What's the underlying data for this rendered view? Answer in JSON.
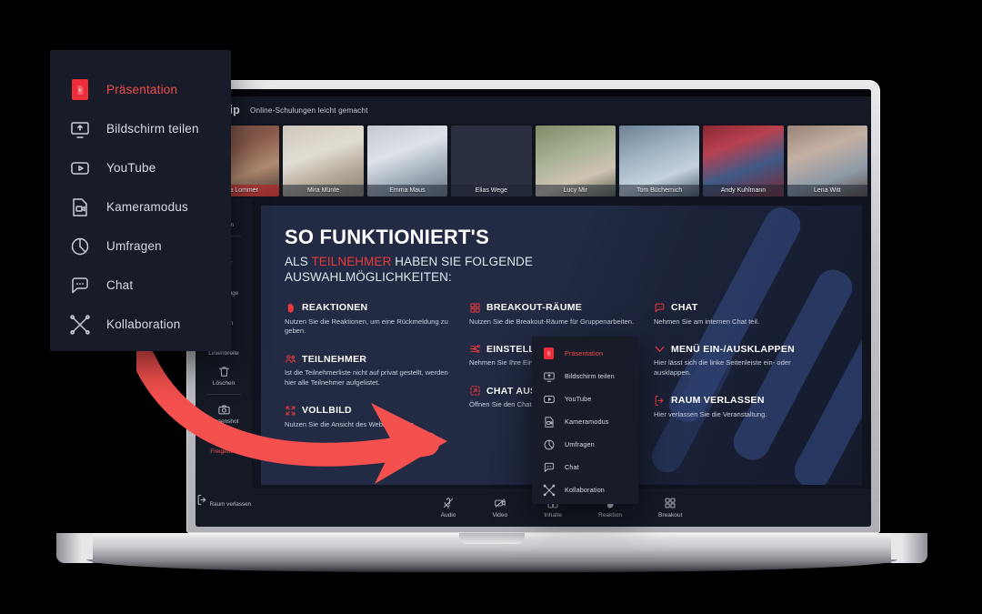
{
  "app": {
    "brand": "dudip",
    "tagline": "Online-Schulungen leicht gemacht"
  },
  "participants": [
    {
      "name": "Anja Lommer",
      "active": true,
      "bg": "linear-gradient(160deg,#6d4a42 0%,#8a5c4c 35%,#b08a72 65%,#4a3730 100%)"
    },
    {
      "name": "Mira Münte",
      "active": false,
      "bg": "linear-gradient(160deg,#cfc6bb 0%,#e2ddd4 40%,#b3a898 70%,#8e8275 100%)"
    },
    {
      "name": "Emma Maus",
      "active": false,
      "bg": "linear-gradient(160deg,#c3c9cf 0%,#dde3e8 38%,#9aa6b2 72%,#6c7884 100%)"
    },
    {
      "name": "Elias Wege",
      "active": false,
      "bg": "linear-gradient(160deg,#7a6a57 0%,#a89madd 0%,#9c8b72 45%,#5e4f3e 100%)"
    },
    {
      "name": "Lucy Mir",
      "active": false,
      "bg": "linear-gradient(160deg,#7e8c6a 0%,#a8b394 40%,#cfc3b2 70%,#5b6450 100%)"
    },
    {
      "name": "Tom Büchernich",
      "active": false,
      "bg": "linear-gradient(160deg,#6e8296 0%,#9fb3c4 38%,#c6d2dc 68%,#4e5e6e 100%)"
    },
    {
      "name": "Andy Kuhlmann",
      "active": false,
      "bg": "linear-gradient(160deg,#8a2733 0%,#b8414f 30%,#3f5a86 60%,#7b2631 100%)"
    },
    {
      "name": "Lena Witt",
      "active": false,
      "bg": "linear-gradient(160deg,#9a8378 0%,#c4b0a3 35%,#8d9aa6 70%,#5d4f48 100%)"
    }
  ],
  "sidebar": {
    "items": [
      {
        "label": "Notizen",
        "icon": "notes-icon",
        "style": "normal"
      },
      {
        "label": "Zeiger",
        "icon": "pointer-icon",
        "style": "normal"
      },
      {
        "label": "Werkzeuge",
        "icon": "tools-icon",
        "style": "normal"
      },
      {
        "label": "Farben",
        "icon": "color-dot-icon",
        "style": "dot"
      },
      {
        "label": "Linienbreite",
        "icon": "line-width-icon",
        "style": "normal"
      },
      {
        "label": "Löschen",
        "icon": "trash-icon",
        "style": "normal"
      },
      {
        "label": "Screenshot",
        "icon": "camera-icon",
        "style": "normal"
      },
      {
        "label": "Freigeben",
        "icon": "lock-icon",
        "style": "red"
      }
    ],
    "leave_label": "Raum verlassen"
  },
  "bottom_bar": {
    "buttons": [
      {
        "label": "Audio",
        "icon": "mic-muted-icon"
      },
      {
        "label": "Video",
        "icon": "camera-muted-icon"
      },
      {
        "label": "Inhalte",
        "icon": "content-icon"
      },
      {
        "label": "Reaktion",
        "icon": "hand-icon"
      },
      {
        "label": "Breakout",
        "icon": "breakout-icon"
      }
    ]
  },
  "slide": {
    "title": "SO FUNKTIONIERT'S",
    "subtitle_pre": "ALS ",
    "subtitle_highlight": "TEILNEHMER",
    "subtitle_post": " HABEN SIE FOLGENDE",
    "subtitle_line2": "AUSWAHLMÖGLICHKEITEN:",
    "columns": [
      {
        "features": [
          {
            "icon": "hand-icon",
            "title": "REAKTIONEN",
            "body": "Nutzen Sie die Reaktionen, um eine Rückmeldung zu geben."
          },
          {
            "icon": "participants-icon",
            "title": "TEILNEHMER",
            "body": "Ist die Teilnehmerliste nicht auf privat gestellt, werden hier alle Teilnehmer aufgelistet."
          },
          {
            "icon": "fullscreen-icon",
            "title": "VOLLBILD",
            "body": "Nutzen Sie die Ansicht des Webinarraums."
          }
        ]
      },
      {
        "features": [
          {
            "icon": "breakout-icon",
            "title": "BREAKOUT-RÄUME",
            "body": "Nutzen Sie die Breakout-Räume für Gruppenarbeiten."
          },
          {
            "icon": "settings-icon",
            "title": "EINSTELLUNGEN",
            "body": "Nehmen Sie Ihre Einstellungen im Webinarraum vor."
          },
          {
            "icon": "popout-icon",
            "title": "CHAT AUSKLAPPEN",
            "body": "Öffnen Sie den Chat in einem eigenen Fenster."
          }
        ]
      },
      {
        "features": [
          {
            "icon": "chat-icon",
            "title": "CHAT",
            "body": "Nehmen Sie am internen Chat teil."
          },
          {
            "icon": "chevron-down-icon",
            "title": "MENÜ EIN-/AUSKLAPPEN",
            "body": "Hier lässt sich die linke Seitenleiste ein- oder ausklappen."
          },
          {
            "icon": "leave-icon",
            "title": "RAUM VERLASSEN",
            "body": "Hier verlassen Sie die Veranstaltung."
          }
        ]
      }
    ]
  },
  "content_menu": {
    "items": [
      {
        "label": "Präsentation",
        "icon": "pdf-icon",
        "active": true
      },
      {
        "label": "Bildschirm teilen",
        "icon": "share-screen-icon",
        "active": false
      },
      {
        "label": "YouTube",
        "icon": "youtube-icon",
        "active": false
      },
      {
        "label": "Kameramodus",
        "icon": "camera-mode-icon",
        "active": false
      },
      {
        "label": "Umfragen",
        "icon": "poll-icon",
        "active": false
      },
      {
        "label": "Chat",
        "icon": "chat-icon",
        "active": false
      },
      {
        "label": "Kollaboration",
        "icon": "collaboration-icon",
        "active": false
      }
    ]
  },
  "colors": {
    "accent_red": "#ef4b4b",
    "highlight_red": "#e8393b",
    "arrow_red": "#f4504e",
    "panel_dark": "#171c28",
    "app_dark": "#141924",
    "slide_blue": "#222a44"
  }
}
